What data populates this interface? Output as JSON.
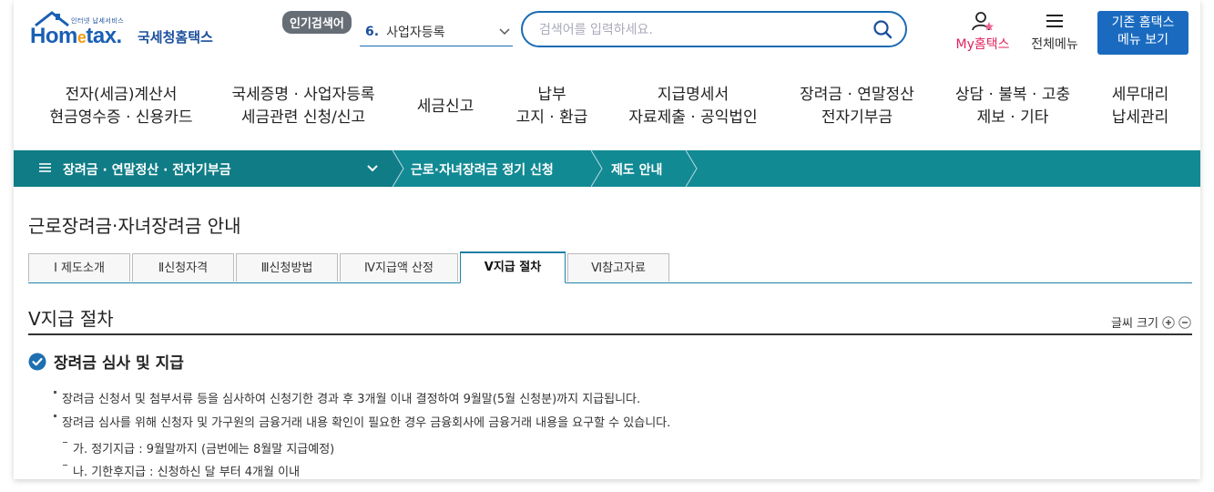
{
  "header": {
    "logo_tagline": "인터넷 납세서비스",
    "logo_brand_pre": "Hom",
    "logo_brand_e": "e",
    "logo_brand_post": "tax.",
    "logo_subtitle": "국세청홈택스",
    "popular_badge": "인기검색어",
    "popular_rank": "6.",
    "popular_keyword": "사업자등록",
    "search_placeholder": "검색어를 입력하세요.",
    "my_label": "My홈택스",
    "allmenu_label": "전체메뉴",
    "classic_line1": "기존 홈택스",
    "classic_line2": "메뉴 보기"
  },
  "gnb": [
    {
      "line1": "전자(세금)계산서",
      "line2": "현금영수증 · 신용카드"
    },
    {
      "line1": "국세증명 · 사업자등록",
      "line2": "세금관련 신청/신고"
    },
    {
      "line1": "세금신고",
      "line2": ""
    },
    {
      "line1": "납부",
      "line2": "고지 · 환급"
    },
    {
      "line1": "지급명세서",
      "line2": "자료제출 · 공익법인"
    },
    {
      "line1": "장려금 · 연말정산",
      "line2": "전자기부금"
    },
    {
      "line1": "상담 · 불복 · 고충",
      "line2": "제보 · 기타"
    },
    {
      "line1": "세무대리",
      "line2": "납세관리"
    }
  ],
  "location": {
    "level1": "장려금 · 연말정산 · 전자기부금",
    "level2": "근로·자녀장려금 정기 신청",
    "level3": "제도 안내"
  },
  "page_title": "근로장려금·자녀장려금 안내",
  "tabs": [
    {
      "label": "Ⅰ 제도소개"
    },
    {
      "label": "Ⅱ신청자격"
    },
    {
      "label": "Ⅲ신청방법"
    },
    {
      "label": "Ⅳ지급액 산정"
    },
    {
      "label": "Ⅴ지급 절차"
    },
    {
      "label": "Ⅵ참고자료"
    }
  ],
  "active_tab": "Ⅴ지급 절차",
  "section": {
    "title": "Ⅴ지급 절차",
    "font_size_label": "글씨 크기",
    "subheading": "장려금 심사 및 지급",
    "bullets": [
      "장려금 신청서 및 첨부서류 등을 심사하여 신청기한 경과 후 3개월 이내 결정하여 9월말(5월 신청분)까지 지급됩니다.",
      "장려금 심사를 위해 신청자 및 가구원의 금융거래 내용 확인이 필요한 경우 금융회사에 금융거래 내용을 요구할 수 있습니다."
    ],
    "sub_bullets": [
      "가. 정기지급 : 9월말까지 (금번에는 8월말 지급예정)",
      "나. 기한후지급 : 신청하신 달 부터 4개월 이내"
    ]
  },
  "colors": {
    "brand_blue": "#1a6bc0",
    "location_bar": "#128a94",
    "my_pink": "#e0245e",
    "check_blue": "#1e6fb0"
  },
  "icons": [
    "search-icon",
    "user-icon",
    "hamburger-icon",
    "chevron-down-icon",
    "plus-icon",
    "minus-icon",
    "check-circle-icon"
  ]
}
